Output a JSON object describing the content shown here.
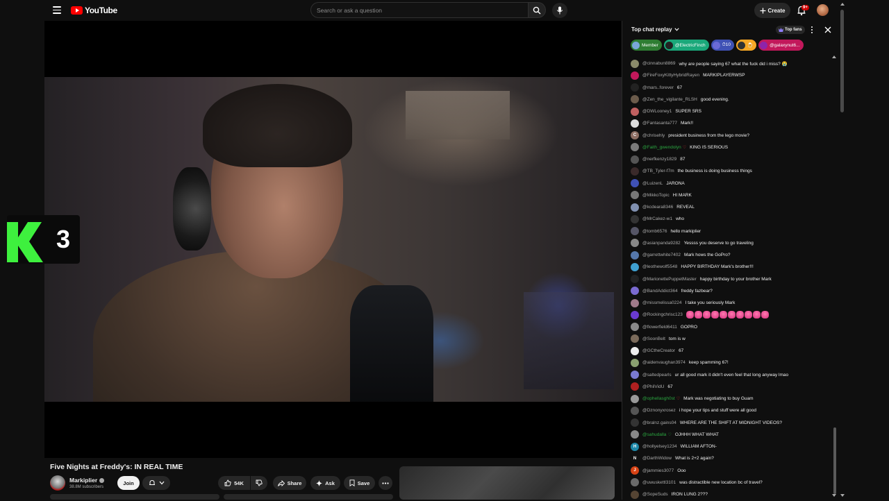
{
  "app": {
    "logo_text": "YouTube"
  },
  "search": {
    "placeholder": "Search or ask a question"
  },
  "header": {
    "create_label": "Create",
    "notification_count": "9+"
  },
  "video": {
    "overlay_number": "3",
    "title": "Five Nights at Freddy's: IN REAL TIME",
    "channel": "Markiplier",
    "subscribers": "38.8M subscribers",
    "join_label": "Join",
    "likes": "54K",
    "share_label": "Share",
    "ask_label": "Ask",
    "save_label": "Save"
  },
  "chat": {
    "title": "Top chat replay",
    "top_fans_label": "Top fans",
    "chips": [
      {
        "label": "Member",
        "color": "#2e7d32",
        "avatar": "#7aa7d8"
      },
      {
        "label": "@ElectricFinch",
        "color": "#1aa87a",
        "avatar": "#222"
      },
      {
        "label": "⏱10",
        "color": "#3f51b5",
        "avatar": "#6a6ad6"
      },
      {
        "label": "🍺",
        "color": "#f9a825",
        "avatar": "#333"
      },
      {
        "label": "@galaxynut6...",
        "color": "#c2185b",
        "avatar": "#8e24aa"
      }
    ],
    "messages": [
      {
        "user": "@cinnabun8869",
        "text": "why are people saying 67 what the fuck did i miss? 😭",
        "avatar": "#8a8a6a",
        "member": false
      },
      {
        "user": "@FireFoxyKittyHybridRayen",
        "text": "MARKIPLAYERWSP",
        "avatar": "#c2185b",
        "member": false
      },
      {
        "user": "@mars..forever",
        "text": "67",
        "avatar": "#222",
        "member": false
      },
      {
        "user": "@Zen_the_vigilante_RLSH",
        "text": "good evening.",
        "avatar": "#6b5b4b",
        "member": false
      },
      {
        "user": "@DWLooney1",
        "text": "SUPER SRS",
        "avatar": "#c06060",
        "member": false
      },
      {
        "user": "@Fantasanta777",
        "text": "Mark!!",
        "avatar": "#dddddd",
        "member": false
      },
      {
        "user": "@chrisehly",
        "text": "president business from the lego movie?",
        "avatar": "#8d6e63",
        "avatar_letter": "C",
        "member": false
      },
      {
        "user": "@Faith_gwendolyn",
        "text": "KING IS SERIOUS",
        "avatar": "#7a7a7a",
        "member": true,
        "heart": "red"
      },
      {
        "user": "@nerfkenzy1829",
        "text": "87",
        "avatar": "#555",
        "member": false
      },
      {
        "user": "@TB_Tyler-f7m",
        "text": "the business is doing business things",
        "avatar": "#3a2a2a",
        "member": false
      },
      {
        "user": "@LuizenL",
        "text": "JARONA",
        "avatar": "#3f51b5",
        "member": false
      },
      {
        "user": "@MikkoTopic",
        "text": "HI MARK",
        "avatar": "#777",
        "member": false
      },
      {
        "user": "@kcdeara8346",
        "text": "REVEAL",
        "avatar": "#8090b0",
        "member": false
      },
      {
        "user": "@MrCakez-w1",
        "text": "who",
        "avatar": "#333",
        "member": false
      },
      {
        "user": "@tomb6576",
        "text": "hello markiplier",
        "avatar": "#556",
        "member": false
      },
      {
        "user": "@asianpanda9282",
        "text": "Yessss you deserve to go traveling",
        "avatar": "#888",
        "member": false
      },
      {
        "user": "@garrettwhite7402",
        "text": "Mark hows the GoPro?",
        "avatar": "#5577aa",
        "member": false
      },
      {
        "user": "@leothewolf5548",
        "text": "HAPPY BIRTHDAY Mark's brother!!!",
        "avatar": "#3fa0d0",
        "member": false
      },
      {
        "user": "@MarionettePuppetMaster",
        "text": "happy birthday to your brother Mark",
        "avatar": "#222",
        "member": false
      },
      {
        "user": "@BandAddict364",
        "text": "freddy fazbear?",
        "avatar": "#7a6ad0",
        "member": false
      },
      {
        "user": "@missmelissa0224",
        "text": "I take you seriously Mark",
        "avatar": "#a07a8a",
        "member": false
      },
      {
        "user": "@Rockingchrisc123",
        "text": "",
        "avatar": "#6a3ad0",
        "emoji_count": 10,
        "member": false
      },
      {
        "user": "@flowerfield6411",
        "text": "GOPRO",
        "avatar": "#8a8a8a",
        "member": false
      },
      {
        "user": "@SoonBelt",
        "text": "tom is w",
        "avatar": "#7a6a5a",
        "member": false
      },
      {
        "user": "@GCtheCreator",
        "text": "67",
        "avatar": "#eee",
        "member": false
      },
      {
        "user": "@aidenvaughan3974",
        "text": "keep spamming 67!",
        "avatar": "#8aa070",
        "member": false
      },
      {
        "user": "@saltedpearls",
        "text": "ur all good mark it didn't even feel that long anyway lmao",
        "avatar": "#7a7ad0",
        "member": false
      },
      {
        "user": "@PhilVidU",
        "text": "67",
        "avatar": "#b02020",
        "member": false
      },
      {
        "user": "@ophellasgh0st",
        "text": "Mark was negotiating to buy Guam",
        "avatar": "#999",
        "member": true,
        "heart": "red"
      },
      {
        "user": "@Dznonyxrosez",
        "text": "i hope your tips and stuff were all good",
        "avatar": "#555",
        "member": false
      },
      {
        "user": "@bralnz.gains04",
        "text": "WHERE ARE THE SHIFT AT MIDNIGHT VIDEOS?",
        "avatar": "#333",
        "member": false
      },
      {
        "user": "@sahudalla",
        "text": "OJHHH WHAT WHAT",
        "avatar": "#888",
        "member": true,
        "heart": "green"
      },
      {
        "user": "@hollyelsey1234",
        "text": "WILLIAM AFTON-",
        "avatar": "#1e88a8",
        "avatar_letter": "H",
        "member": false
      },
      {
        "user": "@DarthWidow",
        "text": "What is 2+2 again?",
        "avatar": "#111",
        "avatar_letter": "N",
        "member": false
      },
      {
        "user": "@jammies3077",
        "text": "Ooo",
        "avatar": "#d84315",
        "avatar_letter": "J",
        "member": false
      },
      {
        "user": "@uwuskettl3101",
        "text": "was distractible new location bc of travel?",
        "avatar": "#6a6a6a",
        "member": false
      },
      {
        "user": "@SopeSuds",
        "text": "IRON LUNG 2???",
        "avatar": "#554433",
        "member": false
      }
    ]
  }
}
